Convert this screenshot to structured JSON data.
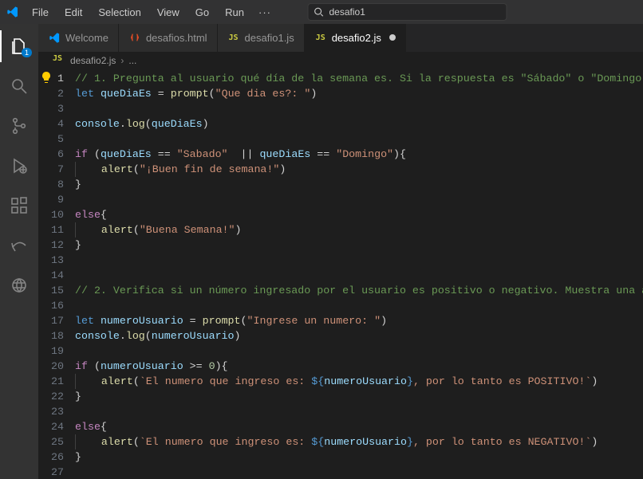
{
  "menu": {
    "items": [
      "File",
      "Edit",
      "Selection",
      "View",
      "Go",
      "Run"
    ],
    "overflow": "···"
  },
  "search": {
    "value": "desafio1"
  },
  "activity": {
    "explorer_badge": "1"
  },
  "tabs": [
    {
      "label": "Welcome",
      "icon": "vs",
      "active": false,
      "dirty": false
    },
    {
      "label": "desafios.html",
      "icon": "html",
      "active": false,
      "dirty": false
    },
    {
      "label": "desafio1.js",
      "icon": "js",
      "active": false,
      "dirty": false
    },
    {
      "label": "desafio2.js",
      "icon": "js",
      "active": true,
      "dirty": true
    }
  ],
  "breadcrumb": {
    "file_icon": "js",
    "file": "desafio2.js",
    "chevron": "›",
    "trail": "..."
  },
  "code": {
    "line_count": 27,
    "current_line": 1,
    "lines": [
      {
        "n": 1,
        "indent": 0,
        "tokens": [
          {
            "c": "c-comment",
            "t": "// 1. Pregunta al usuario qué día de la semana es. Si la respuesta es \"Sábado\" o \"Domingo\""
          }
        ]
      },
      {
        "n": 2,
        "indent": 0,
        "tokens": [
          {
            "c": "c-kw",
            "t": "let"
          },
          {
            "c": "c-punc",
            "t": " "
          },
          {
            "c": "c-var",
            "t": "queDiaEs"
          },
          {
            "c": "c-punc",
            "t": " = "
          },
          {
            "c": "c-func",
            "t": "prompt"
          },
          {
            "c": "c-punc",
            "t": "("
          },
          {
            "c": "c-str",
            "t": "\"Que dia es?: \""
          },
          {
            "c": "c-punc",
            "t": ")"
          }
        ]
      },
      {
        "n": 3,
        "indent": 0,
        "tokens": []
      },
      {
        "n": 4,
        "indent": 0,
        "tokens": [
          {
            "c": "c-var",
            "t": "console"
          },
          {
            "c": "c-punc",
            "t": "."
          },
          {
            "c": "c-func",
            "t": "log"
          },
          {
            "c": "c-punc",
            "t": "("
          },
          {
            "c": "c-var",
            "t": "queDiaEs"
          },
          {
            "c": "c-punc",
            "t": ")"
          }
        ]
      },
      {
        "n": 5,
        "indent": 0,
        "tokens": []
      },
      {
        "n": 6,
        "indent": 0,
        "tokens": [
          {
            "c": "c-ctrl",
            "t": "if"
          },
          {
            "c": "c-punc",
            "t": " ("
          },
          {
            "c": "c-var",
            "t": "queDiaEs"
          },
          {
            "c": "c-punc",
            "t": " == "
          },
          {
            "c": "c-str",
            "t": "\"Sabado\""
          },
          {
            "c": "c-punc",
            "t": "  || "
          },
          {
            "c": "c-var",
            "t": "queDiaEs"
          },
          {
            "c": "c-punc",
            "t": " == "
          },
          {
            "c": "c-str",
            "t": "\"Domingo\""
          },
          {
            "c": "c-punc",
            "t": "){"
          }
        ]
      },
      {
        "n": 7,
        "indent": 1,
        "tokens": [
          {
            "c": "c-func",
            "t": "alert"
          },
          {
            "c": "c-punc",
            "t": "("
          },
          {
            "c": "c-str",
            "t": "\"¡Buen fin de semana!\""
          },
          {
            "c": "c-punc",
            "t": ")"
          }
        ]
      },
      {
        "n": 8,
        "indent": 0,
        "tokens": [
          {
            "c": "c-punc",
            "t": "}"
          }
        ]
      },
      {
        "n": 9,
        "indent": 0,
        "tokens": []
      },
      {
        "n": 10,
        "indent": 0,
        "tokens": [
          {
            "c": "c-ctrl",
            "t": "else"
          },
          {
            "c": "c-punc",
            "t": "{"
          }
        ]
      },
      {
        "n": 11,
        "indent": 1,
        "tokens": [
          {
            "c": "c-func",
            "t": "alert"
          },
          {
            "c": "c-punc",
            "t": "("
          },
          {
            "c": "c-str",
            "t": "\"Buena Semana!\""
          },
          {
            "c": "c-punc",
            "t": ")"
          }
        ]
      },
      {
        "n": 12,
        "indent": 0,
        "tokens": [
          {
            "c": "c-punc",
            "t": "}"
          }
        ]
      },
      {
        "n": 13,
        "indent": 0,
        "tokens": []
      },
      {
        "n": 14,
        "indent": 0,
        "tokens": []
      },
      {
        "n": 15,
        "indent": 0,
        "tokens": [
          {
            "c": "c-comment",
            "t": "// 2. Verifica si un número ingresado por el usuario es positivo o negativo. Muestra una a"
          }
        ]
      },
      {
        "n": 16,
        "indent": 0,
        "tokens": []
      },
      {
        "n": 17,
        "indent": 0,
        "tokens": [
          {
            "c": "c-kw",
            "t": "let"
          },
          {
            "c": "c-punc",
            "t": " "
          },
          {
            "c": "c-var",
            "t": "numeroUsuario"
          },
          {
            "c": "c-punc",
            "t": " = "
          },
          {
            "c": "c-func",
            "t": "prompt"
          },
          {
            "c": "c-punc",
            "t": "("
          },
          {
            "c": "c-str",
            "t": "\"Ingrese un numero: \""
          },
          {
            "c": "c-punc",
            "t": ")"
          }
        ]
      },
      {
        "n": 18,
        "indent": 0,
        "tokens": [
          {
            "c": "c-var",
            "t": "console"
          },
          {
            "c": "c-punc",
            "t": "."
          },
          {
            "c": "c-func",
            "t": "log"
          },
          {
            "c": "c-punc",
            "t": "("
          },
          {
            "c": "c-var",
            "t": "numeroUsuario"
          },
          {
            "c": "c-punc",
            "t": ")"
          }
        ]
      },
      {
        "n": 19,
        "indent": 0,
        "tokens": []
      },
      {
        "n": 20,
        "indent": 0,
        "tokens": [
          {
            "c": "c-ctrl",
            "t": "if"
          },
          {
            "c": "c-punc",
            "t": " ("
          },
          {
            "c": "c-var",
            "t": "numeroUsuario"
          },
          {
            "c": "c-punc",
            "t": " >= "
          },
          {
            "c": "c-num",
            "t": "0"
          },
          {
            "c": "c-punc",
            "t": "){"
          }
        ]
      },
      {
        "n": 21,
        "indent": 1,
        "tokens": [
          {
            "c": "c-func",
            "t": "alert"
          },
          {
            "c": "c-punc",
            "t": "("
          },
          {
            "c": "c-str",
            "t": "`El numero que ingreso es: "
          },
          {
            "c": "c-tplbrace",
            "t": "${"
          },
          {
            "c": "c-tplvar",
            "t": "numeroUsuario"
          },
          {
            "c": "c-tplbrace",
            "t": "}"
          },
          {
            "c": "c-str",
            "t": ", por lo tanto es POSITIVO!`"
          },
          {
            "c": "c-punc",
            "t": ")"
          }
        ]
      },
      {
        "n": 22,
        "indent": 0,
        "tokens": [
          {
            "c": "c-punc",
            "t": "}"
          }
        ]
      },
      {
        "n": 23,
        "indent": 0,
        "tokens": []
      },
      {
        "n": 24,
        "indent": 0,
        "tokens": [
          {
            "c": "c-ctrl",
            "t": "else"
          },
          {
            "c": "c-punc",
            "t": "{"
          }
        ]
      },
      {
        "n": 25,
        "indent": 1,
        "tokens": [
          {
            "c": "c-func",
            "t": "alert"
          },
          {
            "c": "c-punc",
            "t": "("
          },
          {
            "c": "c-str",
            "t": "`El numero que ingreso es: "
          },
          {
            "c": "c-tplbrace",
            "t": "${"
          },
          {
            "c": "c-tplvar",
            "t": "numeroUsuario"
          },
          {
            "c": "c-tplbrace",
            "t": "}"
          },
          {
            "c": "c-str",
            "t": ", por lo tanto es NEGATIVO!`"
          },
          {
            "c": "c-punc",
            "t": ")"
          }
        ]
      },
      {
        "n": 26,
        "indent": 0,
        "tokens": [
          {
            "c": "c-punc",
            "t": "}"
          }
        ]
      },
      {
        "n": 27,
        "indent": 0,
        "tokens": []
      }
    ]
  }
}
